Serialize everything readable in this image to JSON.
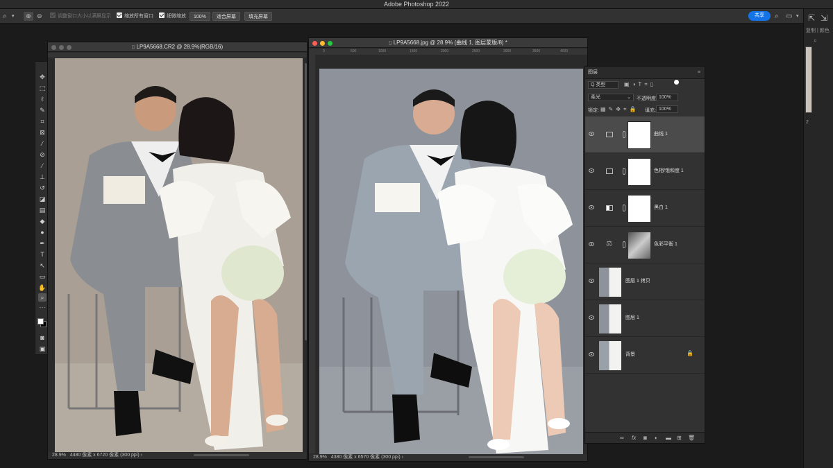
{
  "app": {
    "title": "Adobe Photoshop 2022"
  },
  "options": {
    "resize_label": "调整窗口大小以满屏显示",
    "zoom_all_label": "缩放所有窗口",
    "scrubby_label": "细微缩放",
    "zoom_value": "100%",
    "fit_label": "适合屏幕",
    "fill_label": "填充屏幕",
    "share_label": "共享"
  },
  "right_strip": {
    "label": "复制 | 颜色",
    "value": "2"
  },
  "doc1": {
    "title": "LP9A5668.CR2 @ 28.9%(RGB/16)",
    "zoom": "28.9%",
    "info": "4480 像素 x 6720 像素 (300 ppi)",
    "arrow": "›"
  },
  "doc2": {
    "title": "LP9A5668.jpg @ 28.9% (曲线 1, 图层蒙版/8) *",
    "zoom": "28.9%",
    "info": "4380 像素 x 6570 像素 (300 ppi)",
    "arrow": "›",
    "ruler": [
      "0",
      "500",
      "1000",
      "1500",
      "2000",
      "2500",
      "3000",
      "3500",
      "4000"
    ]
  },
  "layers_panel": {
    "title": "图层",
    "filter": "Q 类型",
    "blend": "柔光",
    "opacity_label": "不透明度:",
    "opacity": "100%",
    "lock_label": "锁定:",
    "fill_label": "填充:",
    "fill": "100%",
    "layers": [
      {
        "name": "曲线 1",
        "kind": "adjustment",
        "icon": "curves-icon",
        "selected": true
      },
      {
        "name": "色相/饱和度 1",
        "kind": "adjustment",
        "icon": "hue-saturation-icon",
        "selected": false
      },
      {
        "name": "黑白 1",
        "kind": "adjustment",
        "icon": "black-white-icon",
        "selected": false
      },
      {
        "name": "色彩平衡 1",
        "kind": "adjustment",
        "icon": "color-balance-icon",
        "selected": false
      },
      {
        "name": "图层 1 拷贝",
        "kind": "pixel",
        "selected": false
      },
      {
        "name": "图层 1",
        "kind": "pixel",
        "selected": false
      },
      {
        "name": "背景",
        "kind": "pixel",
        "locked": true,
        "selected": false
      }
    ]
  },
  "colors": {
    "accent": "#1473e6",
    "panel": "#323232",
    "selected": "#4b4b4b"
  }
}
